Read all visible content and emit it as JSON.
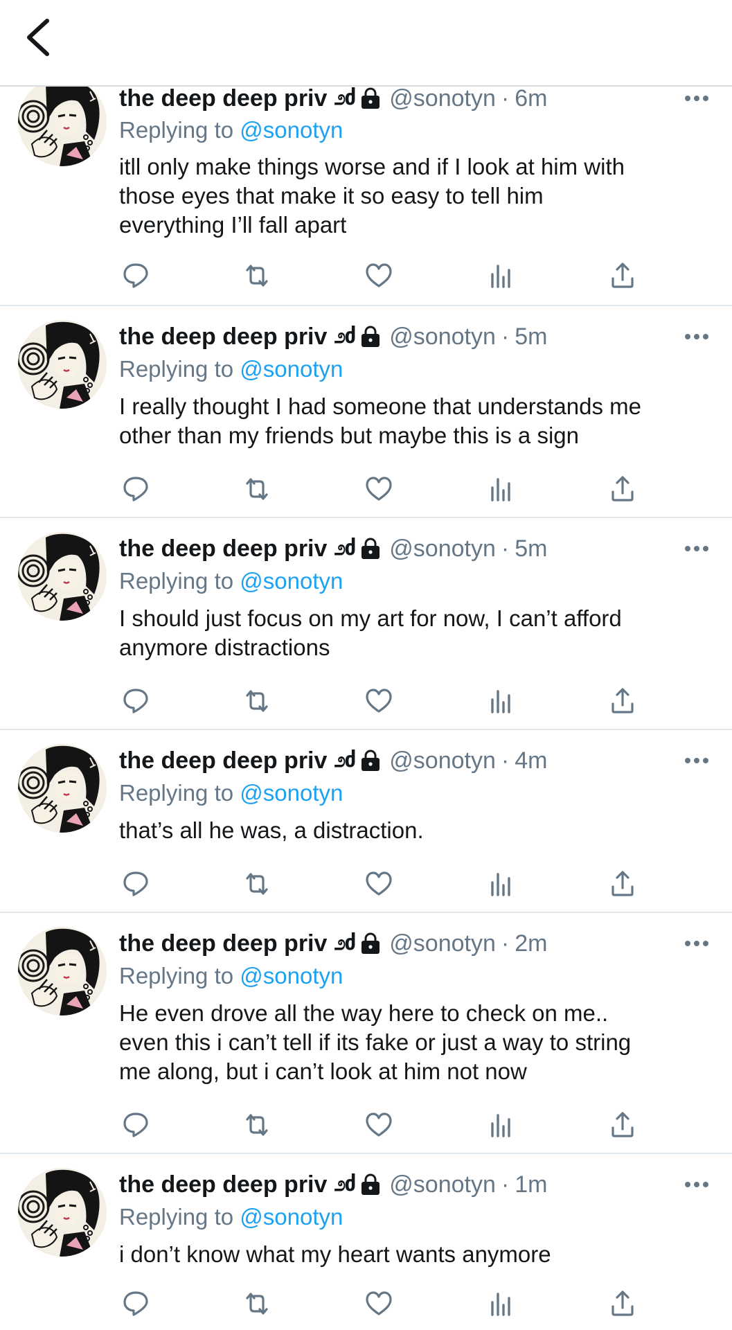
{
  "topbar": {
    "back_icon": "chevron-left-icon"
  },
  "author": {
    "name": "the deep deep priv",
    "badge": "೨ძ",
    "lock_icon": "lock-icon",
    "handle": "@sonotyn",
    "separator": "·"
  },
  "reply_prefix": "Replying to",
  "reply_target": "@sonotyn",
  "colors": {
    "link": "#1da1f2",
    "muted": "#657786",
    "text": "#14171a",
    "divider": "#e1e8ed"
  },
  "action_icons": [
    "reply-icon",
    "retweet-icon",
    "like-icon",
    "analytics-icon",
    "share-icon"
  ],
  "tweets": [
    {
      "time": "6m",
      "text": "itll only make things worse and if I look at him with\nthose eyes that make it so easy to tell him\neverything I’ll fall apart"
    },
    {
      "time": "5m",
      "text": "I really thought I had someone that understands me\nother than my friends but maybe this is a sign"
    },
    {
      "time": "5m",
      "text": "I should just focus on my art for now, I can’t afford\nanymore distractions"
    },
    {
      "time": "4m",
      "text": "that’s all he was, a distraction."
    },
    {
      "time": "2m",
      "text": "He even drove all the way here to check on me..\neven this i can’t tell if its fake or just a way to string\nme along, but i can’t look at him not now"
    },
    {
      "time": "1m",
      "text": "i don’t know what my heart wants anymore"
    }
  ]
}
